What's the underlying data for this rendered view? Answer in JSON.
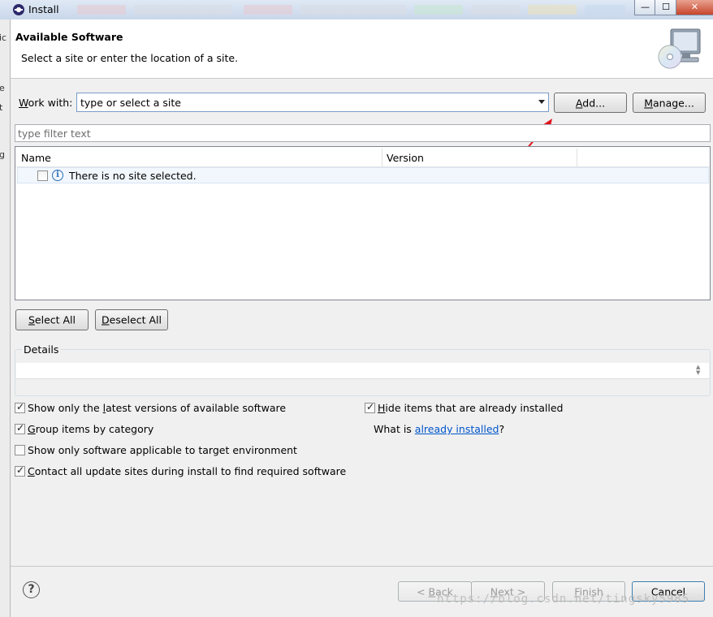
{
  "window": {
    "title": "Install",
    "controls": {
      "minimize": "—",
      "maximize": "☐",
      "close": "✕"
    }
  },
  "left_edge_chars": [
    "ic",
    "e",
    "t",
    "g"
  ],
  "header": {
    "title": "Available Software",
    "description": "Select a site or enter the location of a site.",
    "image_icon": "cd-monitor-icon"
  },
  "work_with": {
    "label_mnemonic": "W",
    "label_rest": "ork with:",
    "value": "type or select a site",
    "add_mnemonic": "A",
    "add_rest": "dd...",
    "manage_mnemonic": "M",
    "manage_rest": "anage..."
  },
  "filter": {
    "placeholder": "type filter text"
  },
  "tree": {
    "columns": [
      "Name",
      "Version"
    ],
    "rows": [
      {
        "text": "There is no site selected.",
        "checked": false
      }
    ]
  },
  "selection_buttons": {
    "select_all_mnemonic": "S",
    "select_all_rest": "elect All",
    "deselect_all_mnemonic": "D",
    "deselect_all_rest": "eselect All"
  },
  "details": {
    "label": "Details"
  },
  "options_left": [
    {
      "pre": "Show only the ",
      "mn": "l",
      "post": "atest versions of available software",
      "checked": true
    },
    {
      "pre": "",
      "mn": "G",
      "post": "roup items by category",
      "checked": true
    },
    {
      "pre": "Show only software applicable to target environment",
      "mn": "",
      "post": "",
      "checked": false
    },
    {
      "pre": "",
      "mn": "C",
      "post": "ontact all update sites during install to find required software",
      "checked": true
    }
  ],
  "options_right": {
    "hide_installed": {
      "pre": "",
      "mn": "H",
      "post": "ide items that are already installed",
      "checked": true
    },
    "what_is_prefix": "What is ",
    "what_is_link": "already installed",
    "what_is_suffix": "?"
  },
  "footer": {
    "back_pre": "< ",
    "back_mn": "B",
    "back_rest": "ack",
    "next_mn": "N",
    "next_rest": "ext >",
    "finish_mn": "F",
    "finish_rest": "inish",
    "cancel": "Cancel",
    "help_icon": "help-icon"
  },
  "watermark": "https://blog.csdn.net/tingsky5985",
  "annotation": {
    "arrow_color": "#e0141e"
  },
  "colors": {
    "link": "#0055cc",
    "banner_bg": "#ffffff",
    "dialog_bg": "#f0f0f0"
  }
}
